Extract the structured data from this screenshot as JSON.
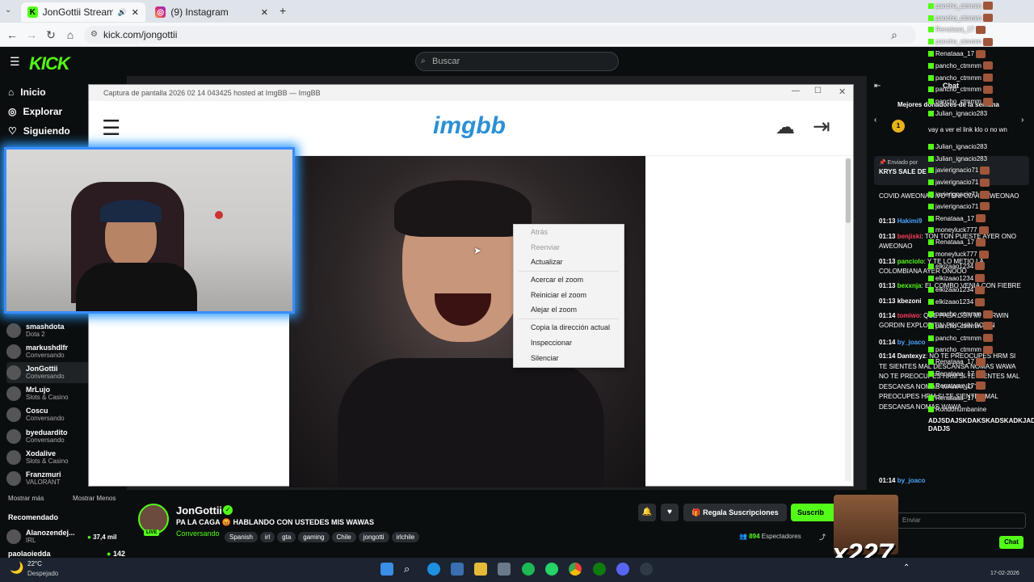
{
  "browser": {
    "tabs": [
      {
        "title": "JonGottii Stream - Watch Li",
        "active": true
      },
      {
        "title": "(9) Instagram",
        "active": false
      }
    ],
    "url": "kick.com/jongottii"
  },
  "kick": {
    "logo": "KICK",
    "search_placeholder": "Buscar",
    "nav": [
      "Inicio",
      "Explorar",
      "Siguiendo"
    ],
    "channels": [
      {
        "name": "smashdota",
        "category": "Dota 2"
      },
      {
        "name": "markushdlfr",
        "category": "Conversando"
      },
      {
        "name": "JonGottii",
        "category": "Conversando"
      },
      {
        "name": "MrLujo",
        "category": "Slots & Casino"
      },
      {
        "name": "Coscu",
        "category": "Conversando"
      },
      {
        "name": "byeduardito",
        "category": "Conversando"
      },
      {
        "name": "Xodalive",
        "category": "Slots & Casino"
      },
      {
        "name": "Franzmuri",
        "category": "VALORANT"
      }
    ],
    "show_more": "Mostrar más",
    "show_less": "Mostrar Menos",
    "recommended_title": "Recomendado",
    "recommended": [
      {
        "name": "Alanozendej...",
        "category": "IRL",
        "viewers": "37,4 mil"
      },
      {
        "name": "paolaoiedda",
        "category": "",
        "viewers": "142"
      }
    ]
  },
  "window": {
    "title": "Captura de pantalla 2026 02 14 043425 hosted at ImgBB — ImgBB",
    "brand": "imgbb"
  },
  "context_menu": {
    "items": [
      {
        "label": "Atrás",
        "disabled": true
      },
      {
        "label": "Reenviar",
        "disabled": true
      },
      {
        "label": "Actualizar",
        "disabled": false
      },
      {
        "label": "Acercar el zoom",
        "disabled": false
      },
      {
        "label": "Reiniciar el zoom",
        "disabled": false
      },
      {
        "label": "Alejar el zoom",
        "disabled": false
      },
      {
        "label": "Copia la dirección actual",
        "disabled": false
      },
      {
        "label": "Inspeccionar",
        "disabled": false
      },
      {
        "label": "Silenciar",
        "disabled": false
      }
    ]
  },
  "stream_info": {
    "streamer": "JonGottii",
    "live_badge": "LIVE",
    "title": "PA LA CAGA 😡 HABLANDO CON USTEDES MIS WAWAS",
    "category": "Conversando",
    "tags": [
      "Spanish",
      "irl",
      "gta",
      "gaming",
      "Chile",
      "jongotti",
      "irlchile"
    ],
    "subscribe_gift": "Regala Suscripciones",
    "subscribe": "Suscrib",
    "viewers": "894",
    "viewers_label": "Espectadores"
  },
  "chat": {
    "title": "Chat",
    "top_donors": "Mejores donadores de la semana",
    "pinned_by": "Enviado por",
    "pinned_text": "KRYS SALE DE",
    "lines": [
      {
        "time": "",
        "user": "",
        "text": "COVID AWEONAO VO TENI COVID AWEONAO"
      },
      {
        "time": "01:13",
        "user": "Hakimi9",
        "text": ""
      },
      {
        "time": "01:13",
        "user": "benjiski",
        "text": "TON TON PUESTE AYER ONO AWEONAO"
      },
      {
        "time": "01:13",
        "user": "panciolo",
        "text": "Y TE LO METIO LA COLOMBIANA AYER ONOOO"
      },
      {
        "time": "01:13",
        "user": "bexxnja",
        "text": "EL COMBO VENIA CON FIEBRE"
      },
      {
        "time": "01:13",
        "user": "kbezoni",
        "text": ""
      },
      {
        "time": "01:14",
        "user": "tomiwo",
        "text": "QUE PASA CON MI DARWIN GORDIN EXPLOTITIN PINCHIN BONIN"
      },
      {
        "time": "01:14",
        "user": "by_joaco",
        "text": ""
      },
      {
        "time": "01:14",
        "user": "Dantexyz",
        "text": "NO TE PREOCUPES HRM SI TE SIENTES MAL DESCANSA NOMAS WAWA NO TE PREOCUPES HRM SI TE SIENTES MAL DESCANSA NOMAS WAWA NO TE PREOCUPES HRM SI TE SIENTES MAL DESCANSA NOMAS WAWA"
      },
      {
        "time": "01:14",
        "user": "by_joaco",
        "text": ""
      }
    ],
    "input_placeholder": "Enviar",
    "chat_button": "Chat"
  },
  "overlay": {
    "count_badge": "x227",
    "usernames": [
      "pancho_ctmmm",
      "Renataaa_17",
      "javierignacio71",
      "Julian_ignacio283",
      "elkizaao1234",
      "moneyluck777",
      "Rond0numbanine"
    ],
    "extra_texts": [
      "vay a ver el link klo o no wn",
      "ADJSDAJSKDAKSKADSKADKJADSA DADJS"
    ]
  },
  "taskbar": {
    "weather_temp": "22°C",
    "weather_text": "Despejado",
    "date": "17-02-2026"
  },
  "colors": {
    "kick_green": "#53fc18",
    "imgbb_blue": "#2a8fd6",
    "cam_glow": "#2e9dff"
  }
}
